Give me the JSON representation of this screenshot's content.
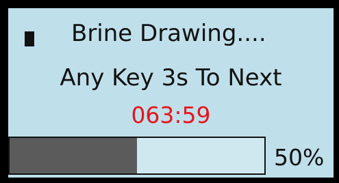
{
  "colors": {
    "frame": "#000000",
    "screen_background": "#bfe0eb",
    "timer": "#e8141b",
    "progress_fill": "#5b5b5b"
  },
  "status": {
    "icon": "square-indicator-icon",
    "title": "Brine Drawing...."
  },
  "prompt": {
    "text": "Any Key 3s To Next"
  },
  "timer": {
    "value": "063:59"
  },
  "progress": {
    "value": 0.5,
    "label": "50%"
  }
}
